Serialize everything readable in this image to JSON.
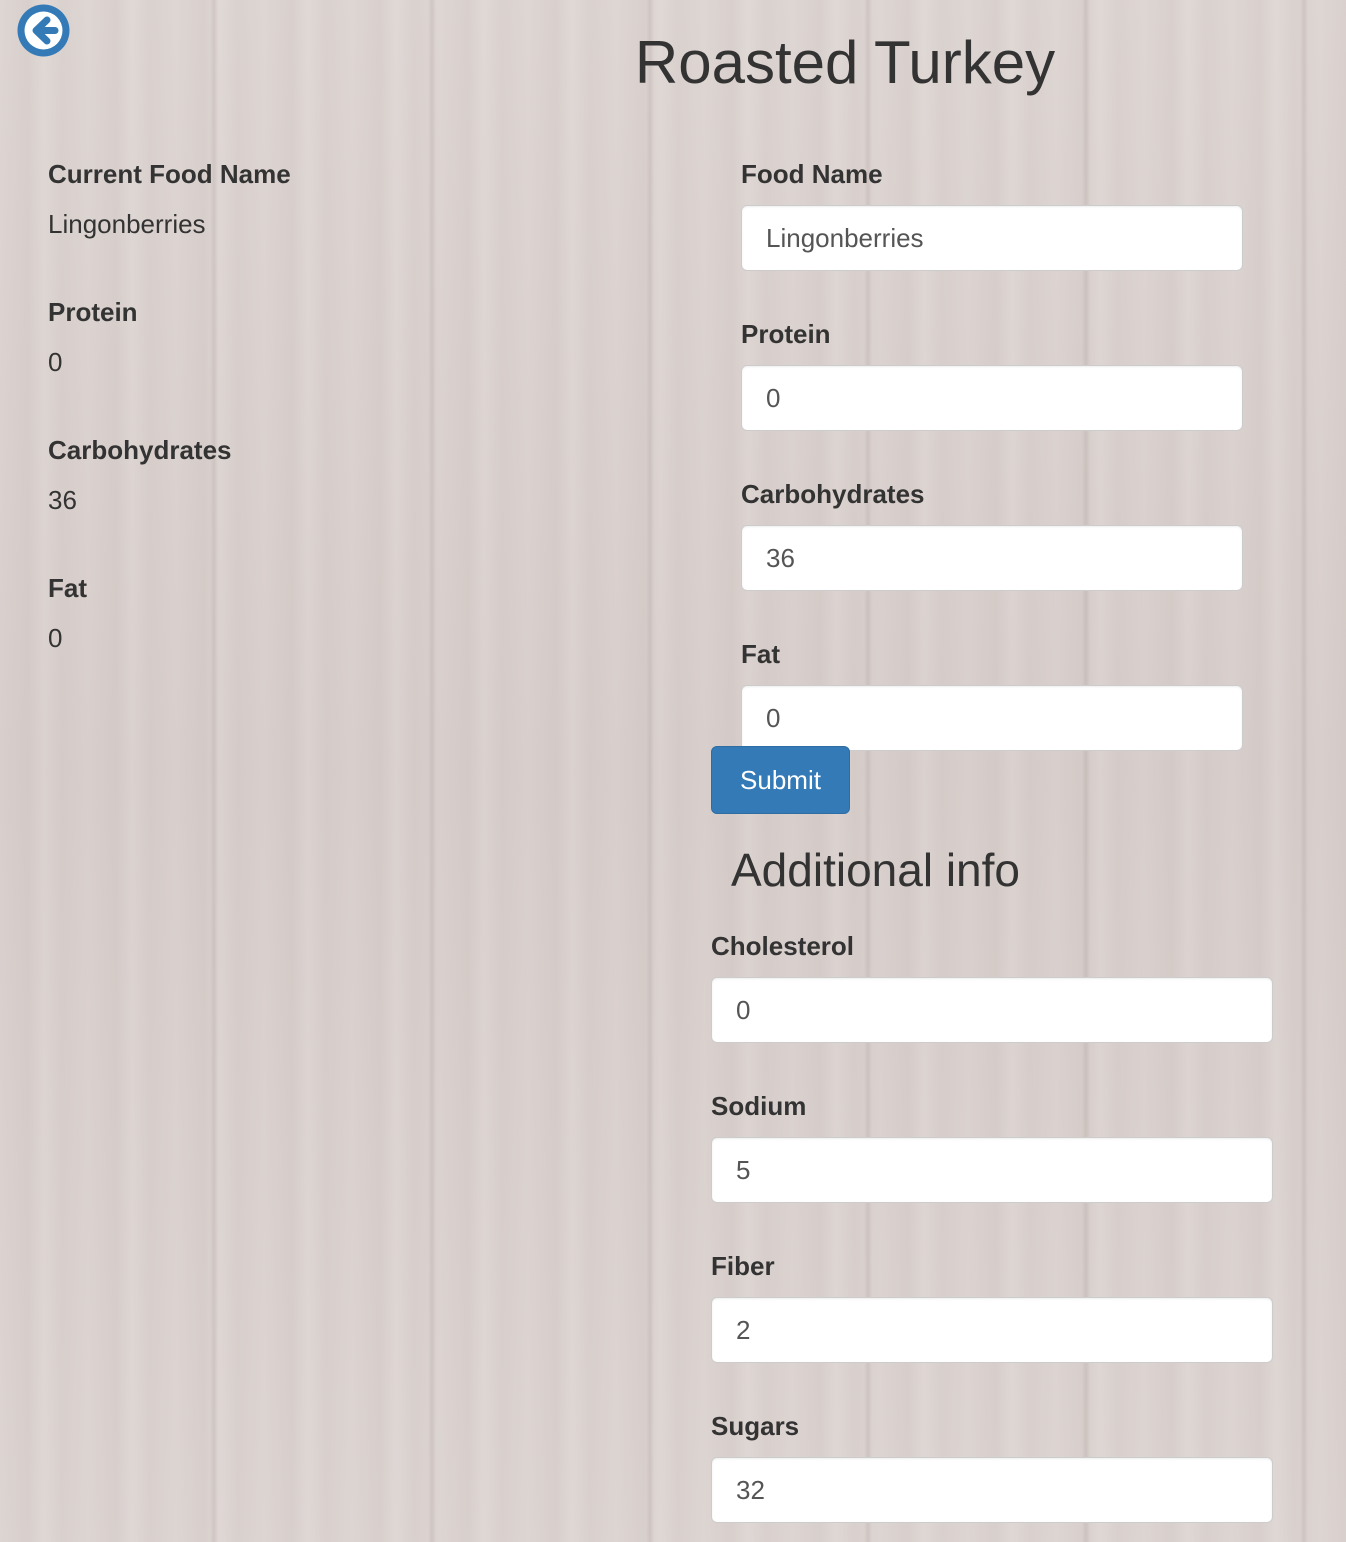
{
  "header": {
    "title": "Roasted Turkey",
    "back_icon": "arrow-left-circle-icon",
    "accent_color": "#337ab7"
  },
  "current": {
    "items": [
      {
        "label": "Current Food Name",
        "value": "Lingonberries"
      },
      {
        "label": "Protein",
        "value": "0"
      },
      {
        "label": "Carbohydrates",
        "value": "36"
      },
      {
        "label": "Fat",
        "value": "0"
      }
    ]
  },
  "form": {
    "fields": [
      {
        "label": "Food Name",
        "value": "Lingonberries"
      },
      {
        "label": "Protein",
        "value": "0"
      },
      {
        "label": "Carbohydrates",
        "value": "36"
      },
      {
        "label": "Fat",
        "value": "0"
      }
    ],
    "submit_label": "Submit"
  },
  "additional": {
    "title": "Additional info",
    "fields": [
      {
        "label": "Cholesterol",
        "value": "0"
      },
      {
        "label": "Sodium",
        "value": "5"
      },
      {
        "label": "Fiber",
        "value": "2"
      },
      {
        "label": "Sugars",
        "value": "32"
      }
    ]
  }
}
